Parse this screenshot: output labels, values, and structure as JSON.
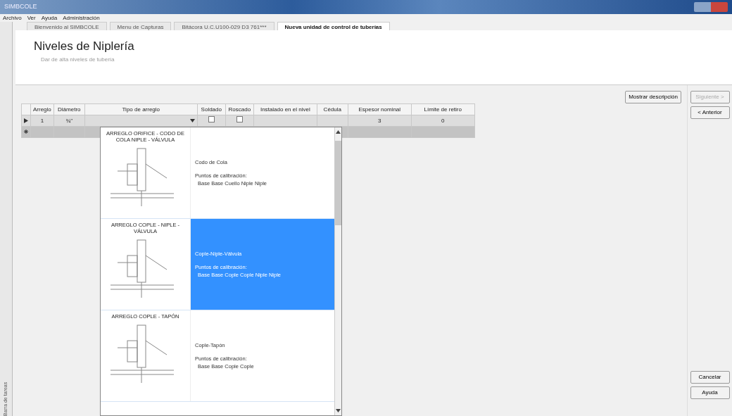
{
  "window": {
    "title": "SIMBCOLE"
  },
  "menu": [
    "Archivo",
    "Ver",
    "Ayuda",
    "Administración"
  ],
  "side_panel": {
    "label": "Barra de tareas"
  },
  "tabs": [
    {
      "label": "Bienvenido al SIMBCOLE",
      "selected": false
    },
    {
      "label": "Menu de Capturas",
      "selected": false
    },
    {
      "label": "Bitácora U.C.U100-029 D3 761***",
      "selected": false
    },
    {
      "label": "Nueva unidad de control de tuberías",
      "selected": true
    }
  ],
  "header": {
    "title": "Niveles de Niplería",
    "subtitle": "Dar de alta niveles de tubería"
  },
  "show_description_button": "Mostrar descripción",
  "table": {
    "columns": [
      "Arreglo",
      "Diámetro",
      "Tipo de arreglo",
      "Soldado",
      "Roscado",
      "Instalado en el nivel",
      "Cédula",
      "Espesor nominal",
      "Límite de retiro"
    ],
    "rows": [
      {
        "kind": "current",
        "arreglo": "1",
        "diametro": "¾\"",
        "tipo": "",
        "soldado": false,
        "roscado": false,
        "nivel": "",
        "cedula": "",
        "espesor": "3",
        "limite": "0"
      },
      {
        "kind": "new"
      }
    ]
  },
  "dropdown": {
    "items": [
      {
        "caption": "ARREGLO ORIFICE - CODO DE COLA NIPLE - VÁLVULA",
        "name": "Codo de Cola",
        "points_label": "Puntos de calibración:",
        "points": "Base Base Cuello Niple Niple",
        "selected": false
      },
      {
        "caption": "ARREGLO COPLE - NIPLE - VÁLVULA",
        "name": "Cople-Niple-Válvula",
        "points_label": "Puntos de calibración:",
        "points": "Base Base Cople Cople Niple Niple",
        "selected": true
      },
      {
        "caption": "ARREGLO COPLE - TAPÓN",
        "name": "Cople-Tapón",
        "points_label": "Puntos de calibración:",
        "points": "Base Base Cople Cople",
        "selected": false
      }
    ]
  },
  "wizard_buttons": [
    {
      "label": "Siguiente >",
      "disabled": true
    },
    {
      "label": "< Anterior",
      "disabled": false
    }
  ],
  "footer_buttons": [
    {
      "label": "Cancelar",
      "disabled": false
    },
    {
      "label": "Ayuda",
      "disabled": false
    }
  ]
}
